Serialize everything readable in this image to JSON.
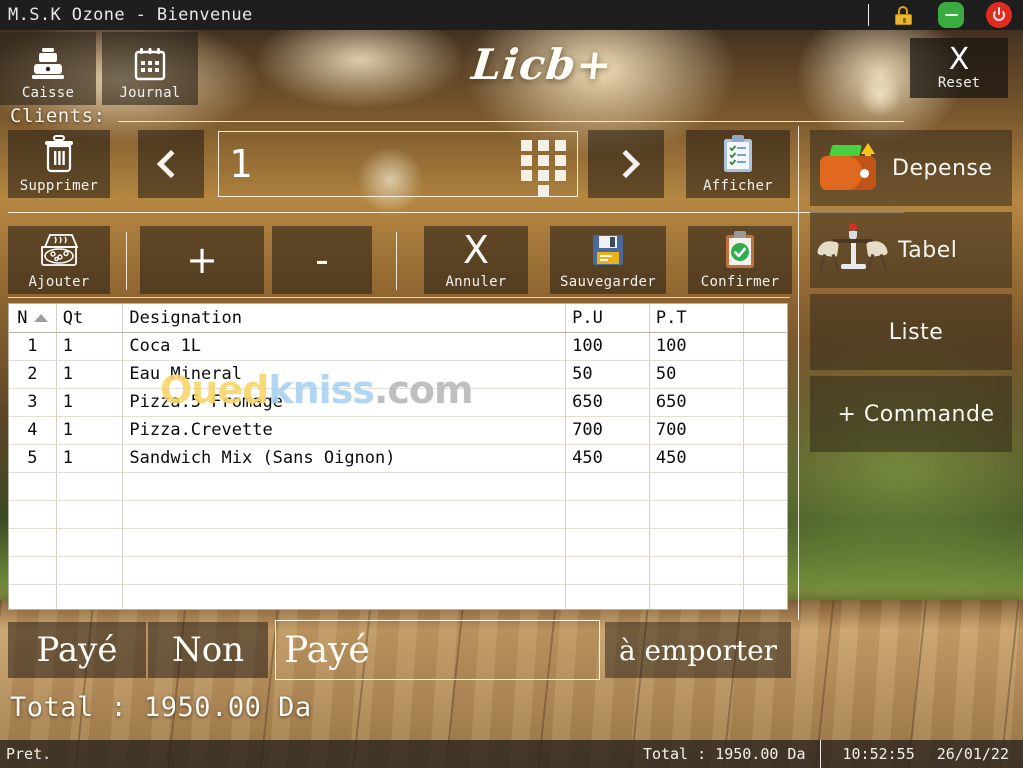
{
  "window": {
    "title": "M.S.K Ozone - Bienvenue",
    "controls": [
      {
        "name": "lock-icon",
        "label": "lock"
      },
      {
        "name": "minimize-icon",
        "label": "minimize"
      },
      {
        "name": "power-icon",
        "label": "power"
      }
    ]
  },
  "toolbar": {
    "tabs": [
      {
        "label": "Caisse",
        "icon": "cash-register-icon"
      },
      {
        "label": "Journal",
        "icon": "calendar-icon"
      }
    ],
    "logo": "Licb+",
    "reset": {
      "symbol": "X",
      "label": "Reset"
    }
  },
  "clients": {
    "label": "Clients:",
    "delete": {
      "label": "Supprimer",
      "icon": "trash-icon"
    },
    "prev": {
      "icon": "chevron-left-icon"
    },
    "number_value": "1",
    "keypad": {
      "icon": "numeric-keypad-icon"
    },
    "next": {
      "icon": "chevron-right-icon"
    },
    "show": {
      "label": "Afficher",
      "icon": "clipboard-list-icon"
    }
  },
  "actions": {
    "add": {
      "label": "Ajouter",
      "icon": "pizza-box-icon"
    },
    "plus": {
      "symbol": "+"
    },
    "minus": {
      "symbol": "-"
    },
    "cancel": {
      "label": "Annuler",
      "symbol": "X"
    },
    "save": {
      "label": "Sauvegarder",
      "icon": "floppy-disk-icon"
    },
    "confirm": {
      "label": "Confirmer",
      "icon": "clipboard-check-icon"
    }
  },
  "sidebar": {
    "items": [
      {
        "label": "Depense",
        "icon": "wallet-money-icon"
      },
      {
        "label": "Tabel",
        "icon": "dining-table-icon"
      },
      {
        "label": "Liste",
        "icon": ""
      },
      {
        "label": "+ Commande",
        "icon": ""
      }
    ]
  },
  "order_table": {
    "columns": [
      "N",
      "Qt",
      "Designation",
      "P.U",
      "P.T",
      ""
    ],
    "sort_column": "N",
    "sort_direction": "asc",
    "rows": [
      {
        "n": "1",
        "qt": "1",
        "designation": "Coca 1L",
        "pu": "100",
        "pt": "100"
      },
      {
        "n": "2",
        "qt": "1",
        "designation": "Eau Mineral",
        "pu": "50",
        "pt": "50"
      },
      {
        "n": "3",
        "qt": "1",
        "designation": "Pizza.5 Fromage",
        "pu": "650",
        "pt": "650"
      },
      {
        "n": "4",
        "qt": "1",
        "designation": "Pizza.Crevette",
        "pu": "700",
        "pt": "700"
      },
      {
        "n": "5",
        "qt": "1",
        "designation": "Sandwich Mix (Sans Oignon)",
        "pu": "450",
        "pt": "450"
      }
    ],
    "empty_rows": 5
  },
  "watermark": {
    "part1": "Oued",
    "part2": "kniss",
    "part3": ".com"
  },
  "payment": {
    "paid_button": "Payé",
    "non_button": "Non",
    "status_value": "Payé",
    "takeaway_button": "à emporter",
    "total_text": "Total : 1950.00 Da"
  },
  "statusbar": {
    "state": "Pret.",
    "total": "Total : 1950.00 Da",
    "time": "10:52:55",
    "date": "26/01/22"
  },
  "colors": {
    "titlebar": "#1e1e1e",
    "lock": "#e8b92c",
    "minimize": "#3aab3f",
    "power": "#e02b20",
    "accent_cream": "#fffaeb",
    "table_bg": "#ffffff"
  }
}
